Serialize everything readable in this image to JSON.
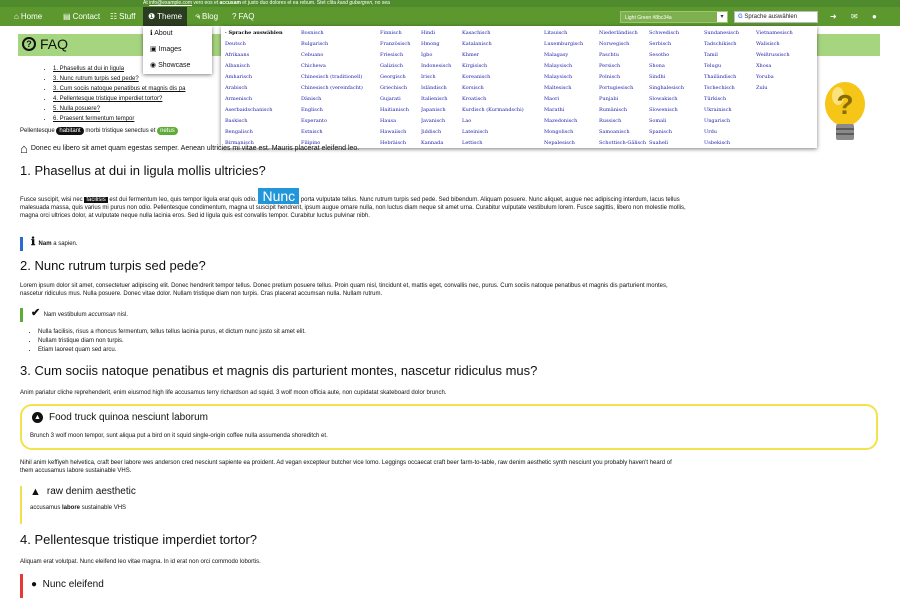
{
  "topbar": {
    "prefix": "At ",
    "email": "info@example.com",
    "text_a": " vero eos et ",
    "bold": "accusam",
    "text_b": " et justo duo dolores et ea rebum. Stet clita ",
    "ital": "kasd gubergren",
    "text_c": ", no sea"
  },
  "nav": {
    "home": "Home",
    "contact": "Contact",
    "stuff": "Stuff",
    "theme": "Theme",
    "blog": "Blog",
    "faq": "FAQ",
    "theme_select": "Light Green #8bc34a",
    "translate": "Sprache auswählen"
  },
  "theme_menu": {
    "about": "About",
    "images": "Images",
    "showcase": "Showcase"
  },
  "header": {
    "title": "FAQ"
  },
  "toc": [
    "1. Phasellus at dui in ligula",
    "3. Nunc rutrum turpis sed pede?",
    "3. Cum sociis natoque penatibus et magnis dis pa",
    "4. Pellentesque tristique imperdiet tortor?",
    "5. Nulla posuere?",
    "6. Praesent fermentum tempor"
  ],
  "languages": [
    "· Sprache auswählen",
    "Bosnisch",
    "Finnisch",
    "Hindi",
    "Kasachisch",
    "Litauisch",
    "Niederländisch",
    "Schwedisch",
    "Sundanesisch",
    "Vietnamesisch",
    "Deutsch",
    "Bulgarisch",
    "Französisch",
    "Hmong",
    "Katalanisch",
    "Luxemburgisch",
    "Norwegisch",
    "Serbisch",
    "Tadschikisch",
    "Walisisch",
    "Afrikaans",
    "Cebuano",
    "Friesisch",
    "Igbo",
    "Khmer",
    "Malagasy",
    "Paschtu",
    "Sesotho",
    "Tamil",
    "Weißrussisch",
    "Albanisch",
    "Chichewa",
    "Galizisch",
    "Indonesisch",
    "Kirgisisch",
    "Malaysisch",
    "Persisch",
    "Shona",
    "Telugu",
    "Xhosa",
    "Amharisch",
    "Chinesisch (traditionell)",
    "Georgisch",
    "Irisch",
    "Koreanisch",
    "Malaysisch",
    "Polnisch",
    "Sindhi",
    "Thailändisch",
    "Yoruba",
    "Arabisch",
    "Chinesisch (vereinfacht)",
    "Griechisch",
    "Isländisch",
    "Korsisch",
    "Maltesisch",
    "Portugiesisch",
    "Singhalesisch",
    "Tschechisch",
    "Zulu",
    "Armenisch",
    "Dänisch",
    "Gujarati",
    "Italienisch",
    "Kroatisch",
    "Maori",
    "Punjabi",
    "Slowakisch",
    "Türkisch",
    "",
    "Aserbaidschanisch",
    "Englisch",
    "Haitianisch",
    "Japanisch",
    "Kurdisch (Kurmandschi)",
    "Marathi",
    "Rumänisch",
    "Slowenisch",
    "Ukrainisch",
    "",
    "Baskisch",
    "Esperanto",
    "Hausa",
    "Javanisch",
    "Lao",
    "Mazedonisch",
    "Russisch",
    "Somali",
    "Ungarisch",
    "",
    "Bengalisch",
    "Estnisch",
    "Hawaiisch",
    "Jiddisch",
    "Lateinisch",
    "Mongolisch",
    "Samoanisch",
    "Spanisch",
    "Urdu",
    "",
    "Birmanisch",
    "Filipino",
    "Hebräisch",
    "Kannada",
    "Lettisch",
    "Nepalesisch",
    "Schottisch-Gälisch",
    "Suaheli",
    "Usbekisch",
    ""
  ],
  "intro": {
    "a": "Pellentesque ",
    "pill1": "habitant",
    "b": " morbi tristique senectus et ",
    "pill2": "netus"
  },
  "home_line": "Donec eu libero sit amet quam egestas semper. Aenean ultricies mi vitae est. Mauris placerat eleifend leo.",
  "s1": {
    "title": "1. Phasellus at dui in ligula mollis ultricies?",
    "p_a": "Fusce suscipit, wisi nec ",
    "hl1": "facilisis",
    "p_b": " est dui fermentum leo, quis tempor ligula erat quis odio. ",
    "hl2": "Nunc",
    "p_c": " porta vulputate tellus. Nunc rutrum turpis sed pede. Sed bibendum. Aliquam posuere. Nunc aliquet, augue nec adipiscing interdum, lacus tellus",
    "p2": "malesuada massa, quis varius mi purus non odio. Pellentesque condimentum, magna ut suscipit hendrerit, ipsum augue ornare nulla, non luctus diam neque sit amet urna. Curabitur vulputate vestibulum lorem. Fusce sagittis, libero non molestie mollis,",
    "p3": "magna orci ultrices dolor, at vulputate neque nulla lacinia eros. Sed id ligula quis est convallis tempor. Curabitur luctus pulvinar nibh.",
    "note_b": "Nam",
    "note": " a sapien."
  },
  "s2": {
    "title": "2. Nunc rutrum turpis sed pede?",
    "p1": "Lorem ipsum dolor sit amet, consectetuer adipiscing elit. Donec hendrerit tempor tellus. Donec pretium posuere tellus. Proin quam nisl, tincidunt et, mattis eget, convallis nec, purus. Cum sociis natoque penatibus et magnis dis parturient montes,",
    "p2": "nascetur ridiculus mus. Nulla posuere. Donec vitae dolor. Nullam tristique diam non turpis. Cras placerat accumsan nulla. Nullam rutrum.",
    "note_a": "Nam vestibulum ",
    "note_i": "accumsan",
    "note_b": " nisl.",
    "list": [
      "Nulla facilisis, risus a rhoncus fermentum, tellus tellus lacinia purus, et dictum nunc justo sit amet elit.",
      "Nullam tristique diam non turpis.",
      "Etiam laoreet quam sed arcu."
    ]
  },
  "s3": {
    "title": "3. Cum sociis natoque penatibus et magnis dis parturient montes, nascetur ridiculus mus?",
    "p1": "Anim pariatur cliche reprehenderit, enim eiusmod high life accusamus terry richardson ad squid. 3 wolf moon officia aute, non cupidatat skateboard dolor brunch.",
    "box_title": "Food truck quinoa nesciunt laborum",
    "box_text": "Brunch 3 wolf moon tempor, sunt aliqua put a bird on it squid single-origin coffee nulla assumenda shoreditch et.",
    "p2": "Nihil anim keffiyeh helvetica, craft beer labore wes anderson cred nesciunt sapiente ea proident. Ad vegan excepteur butcher vice lomo. Leggings occaecat craft beer farm-to-table, raw denim aesthetic synth nesciunt you probably haven't heard of",
    "p3": "them accusamus labore sustainable VHS.",
    "warn_title": "raw denim aesthetic",
    "warn_a": "accusamus ",
    "warn_b": "labore",
    "warn_c": " sustainable VHS"
  },
  "s4": {
    "title": "4. Pellentesque tristique imperdiet tortor?",
    "p1": "Aliquam erat volutpat. Nunc eleifend leo vitae magna. In id erat non orci commodo lobortis.",
    "note": "Nunc eleifend"
  },
  "colors": {
    "nav": "#5d982f",
    "topbar": "#4f8a2d",
    "header": "#a6d57f",
    "accent_blue": "#2196d9",
    "warn": "#f2e34a"
  }
}
